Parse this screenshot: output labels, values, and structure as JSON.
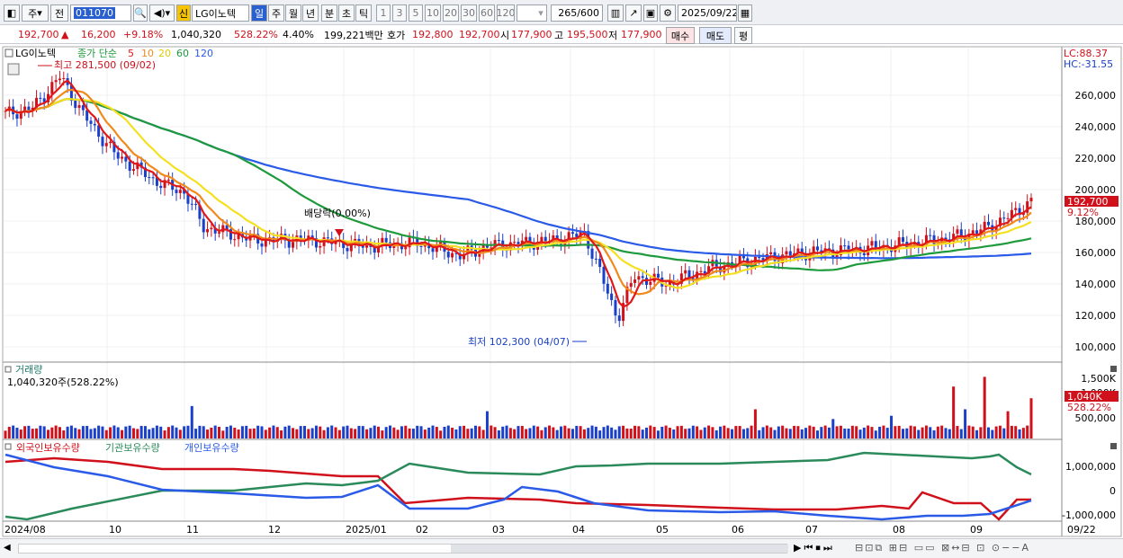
{
  "toolbar": {
    "period": "주",
    "prev": "전",
    "code": "011070",
    "stock_name": "LG이노텍",
    "badge": "신",
    "tab_day": "일",
    "tab_week": "주",
    "tab_month": "월",
    "tab_year": "년",
    "tab_min": "분",
    "tab_sec": "초",
    "tab_tick": "틱",
    "nums": [
      "1",
      "3",
      "5",
      "10",
      "20",
      "30",
      "60",
      "120"
    ],
    "count": "265",
    "total": "/600",
    "date": "2025/09/22"
  },
  "quote": {
    "price": "192,700",
    "arrow": "▲",
    "change": "16,200",
    "pct": "+9.18%",
    "volume": "1,040,320",
    "vol_ratio": "528.22%",
    "turnover": "4.40%",
    "amount": "199,221백만",
    "label_hoga": "호가",
    "ask": "192,800",
    "bid": "192,700",
    "label_open": "시",
    "open": "177,900",
    "label_high": "고",
    "high": "195,500",
    "label_low": "저",
    "low": "177,900",
    "buy": "매수",
    "sell": "매도",
    "eval": "평"
  },
  "price_panel": {
    "name": "LG이노텍",
    "ma_label": "종가 단순",
    "ma": [
      "5",
      "10",
      "20",
      "60",
      "120"
    ],
    "high_note": "최고 281,500 (09/02)",
    "low_note": "최저 102,300 (04/07)",
    "dividend": "배당락(0.00%)",
    "lc": "LC:88.37",
    "hc": "HC:-31.55",
    "last_price": "192,700",
    "last_pct": "9.12%",
    "y_labels": [
      "260,000",
      "240,000",
      "220,000",
      "200,000",
      "180,000",
      "160,000",
      "140,000",
      "120,000",
      "100,000"
    ]
  },
  "volume_panel": {
    "title": "거래량",
    "value": "1,040,320주(528.22%)",
    "y_labels": [
      "1,500K",
      "1,000K",
      "500,000"
    ],
    "last": "1,040K",
    "last_pct": "528.22%"
  },
  "holdings_panel": {
    "s1": "외국인보유수량",
    "s2": "기관보유수량",
    "s3": "개인보유수량",
    "y_labels": [
      "1,000,000",
      "0",
      "-1,000,000"
    ]
  },
  "x_axis": {
    "labels": [
      "2024/08",
      "10",
      "11",
      "12",
      "2025/01",
      "02",
      "03",
      "04",
      "05",
      "06",
      "07",
      "08",
      "09",
      "09/22"
    ]
  },
  "colors": {
    "up": "#d0101a",
    "down": "#1a3fc8",
    "ma5": "#e01818",
    "ma10": "#f08a1c",
    "ma20": "#f5e020",
    "ma60": "#1e9a3c",
    "ma120": "#2a5ae8",
    "foreign": "#d0101a",
    "inst": "#2a8a5a",
    "indiv": "#2a5ae8"
  }
}
